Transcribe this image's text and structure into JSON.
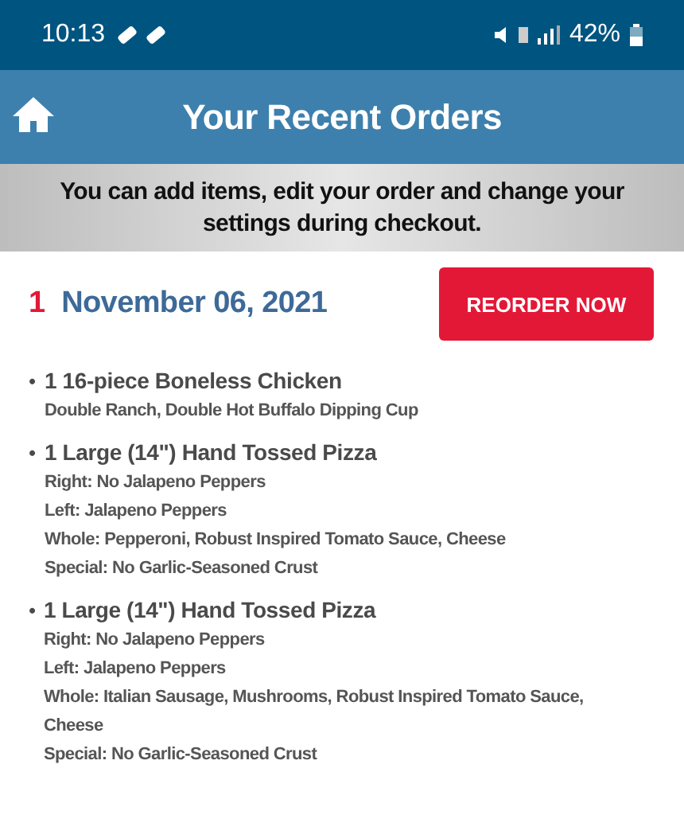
{
  "status_bar": {
    "time": "10:13",
    "battery": "42%"
  },
  "header": {
    "title": "Your Recent Orders"
  },
  "banner": {
    "text": "You can add items, edit your order and change your settings during checkout."
  },
  "order": {
    "number": "1",
    "date": "November 06, 2021",
    "button": "REORDER NOW",
    "items": [
      {
        "marker": "•",
        "name": "1 16-piece Boneless Chicken",
        "details": [
          "Double Ranch, Double Hot Buffalo Dipping Cup"
        ]
      },
      {
        "marker": "•",
        "name": "1 Large (14\") Hand Tossed Pizza",
        "details": [
          "Right: No Jalapeno Peppers",
          "Left: Jalapeno Peppers",
          "Whole: Pepperoni, Robust Inspired Tomato Sauce, Cheese",
          "Special: No Garlic-Seasoned Crust"
        ]
      },
      {
        "marker": "•",
        "name": "1 Large (14\") Hand Tossed Pizza",
        "details": [
          "Right: No Jalapeno Peppers",
          "Left: Jalapeno Peppers",
          "Whole: Italian Sausage, Mushrooms, Robust Inspired Tomato Sauce, Cheese",
          "Special: No Garlic-Seasoned Crust"
        ]
      }
    ]
  }
}
